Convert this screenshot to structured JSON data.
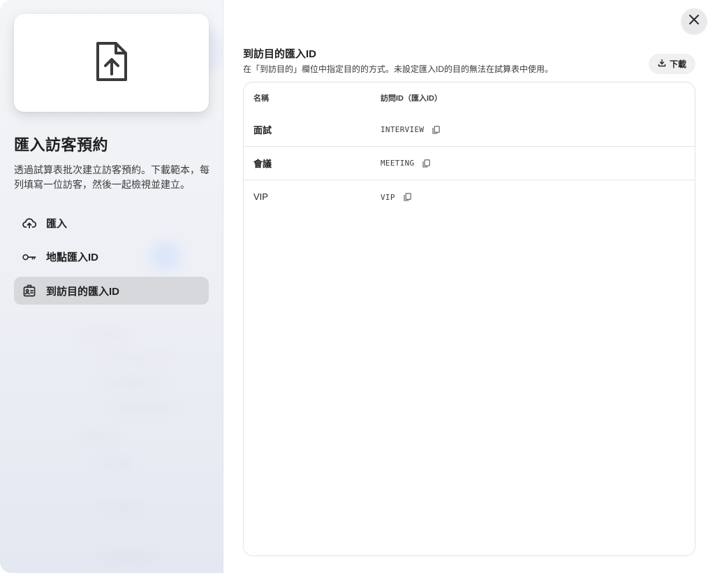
{
  "sidebar": {
    "hero_icon": "file-upload-icon",
    "title": "匯入訪客預約",
    "description": "透過試算表批次建立訪客預約。下載範本，每列填寫一位訪客，然後一起檢視並建立。",
    "items": [
      {
        "label": "匯入",
        "icon": "cloud-upload-icon",
        "active": false
      },
      {
        "label": "地點匯入ID",
        "icon": "key-icon",
        "active": false
      },
      {
        "label": "到訪目的匯入ID",
        "icon": "id-card-icon",
        "active": true
      }
    ]
  },
  "main": {
    "title": "到訪目的匯入ID",
    "description": "在「到訪目的」欄位中指定目的的方式。未設定匯入ID的目的無法在試算表中使用。",
    "download_label": "下載",
    "table": {
      "headers": [
        "名稱",
        "訪問ID（匯入ID）"
      ],
      "rows": [
        {
          "name": "面試",
          "id": "INTERVIEW"
        },
        {
          "name": "會議",
          "id": "MEETING"
        },
        {
          "name": "VIP",
          "id": "VIP"
        }
      ]
    }
  },
  "colors": {
    "active_item_bg": "#d7d8dc",
    "text_primary": "#1f1f1f",
    "border": "#e3e3e6"
  }
}
